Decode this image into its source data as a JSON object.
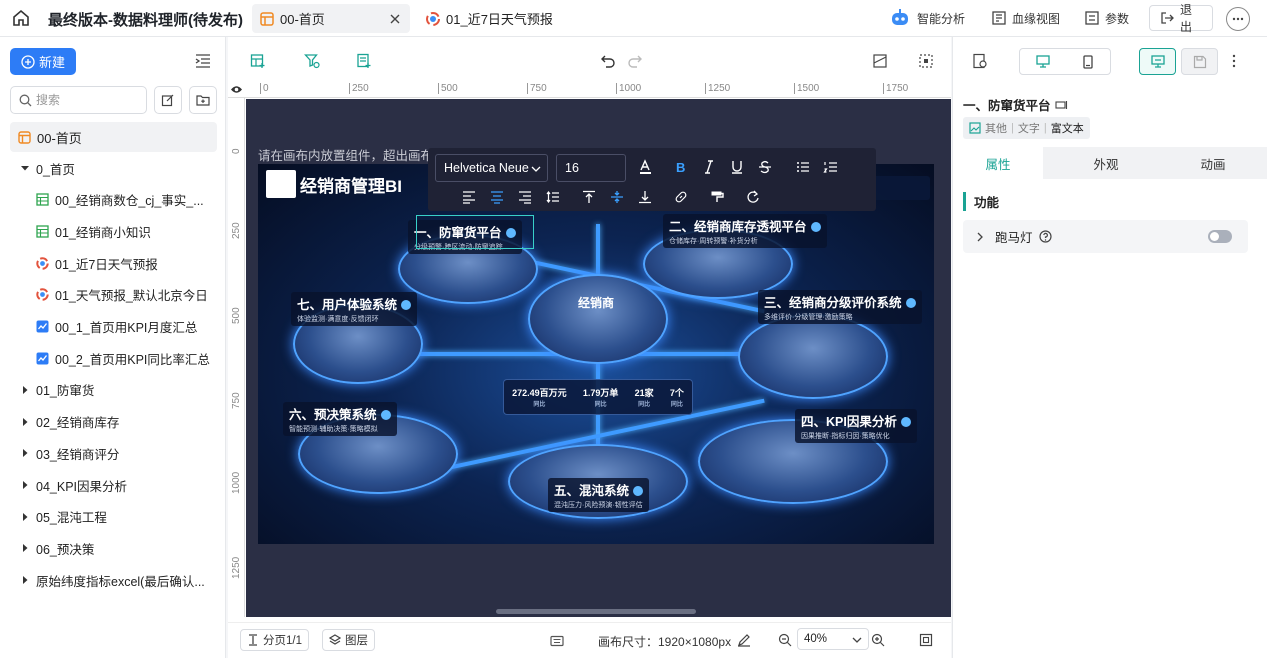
{
  "header": {
    "app_title": "最终版本-数据料理师(待发布)",
    "tabs": [
      {
        "label": "00-首页",
        "active": true
      },
      {
        "label": "01_近7日天气预报",
        "active": false
      }
    ],
    "actions": {
      "ai": "智能分析",
      "lineage": "血缘视图",
      "params": "参数",
      "exit": "退出"
    }
  },
  "sidebar": {
    "new_label": "新建",
    "search_placeholder": "搜索",
    "root": "00-首页",
    "items": [
      {
        "label": "0_首页",
        "type": "folder-open",
        "indent": 1
      },
      {
        "label": "00_经销商数仓_cj_事实_...",
        "type": "table",
        "indent": 2
      },
      {
        "label": "01_经销商小知识",
        "type": "table",
        "indent": 2
      },
      {
        "label": "01_近7日天气预报",
        "type": "chart",
        "indent": 2
      },
      {
        "label": "01_天气预报_默认北京今日",
        "type": "chart",
        "indent": 2
      },
      {
        "label": "00_1_首页用KPI月度汇总",
        "type": "line",
        "indent": 2
      },
      {
        "label": "00_2_首页用KPI同比率汇总",
        "type": "line",
        "indent": 2
      },
      {
        "label": "01_防窜货",
        "type": "folder",
        "indent": 1
      },
      {
        "label": "02_经销商库存",
        "type": "folder",
        "indent": 1
      },
      {
        "label": "03_经销商评分",
        "type": "folder",
        "indent": 1
      },
      {
        "label": "04_KPI因果分析",
        "type": "folder",
        "indent": 1
      },
      {
        "label": "05_混沌工程",
        "type": "folder",
        "indent": 1
      },
      {
        "label": "06_预决策",
        "type": "folder",
        "indent": 1
      },
      {
        "label": "原始纬度指标excel(最后确认...",
        "type": "folder",
        "indent": 1
      }
    ]
  },
  "canvas": {
    "ruler_x": [
      "0",
      "250",
      "500",
      "750",
      "1000",
      "1250",
      "1500",
      "1750"
    ],
    "ruler_y": [
      "0",
      "250",
      "500",
      "750",
      "1000",
      "1250"
    ],
    "hint": "请在画布内放置组件，超出画布外的内容无法显示",
    "picture": {
      "title": "经销商管理BI",
      "center": "经销商",
      "modules": [
        {
          "name": "一、防窜货平台",
          "sub": "分级预警·跨区流动·防窜追踪"
        },
        {
          "name": "二、经销商库存透视平台",
          "sub": "仓储库存·周转预警·补货分析"
        },
        {
          "name": "三、经销商分级评价系统",
          "sub": "多维评价·分级管理·激励策略"
        },
        {
          "name": "四、KPI因果分析",
          "sub": "因果推断·指标归因·策略优化"
        },
        {
          "name": "五、混沌系统",
          "sub": "混沌压力·风险预演·韧性评估"
        },
        {
          "name": "六、预决策系统",
          "sub": "智能预测·辅助决策·策略模拟"
        },
        {
          "name": "七、用户体验系统",
          "sub": "体验监测·满意度·反馈闭环"
        }
      ],
      "stats": [
        {
          "value": "272.49百万元",
          "note": "同比"
        },
        {
          "value": "1.79万单",
          "note": "同比"
        },
        {
          "value": "21家",
          "note": "同比"
        },
        {
          "value": "7个",
          "note": "同比"
        }
      ]
    },
    "format_bar": {
      "font": "Helvetica Neue",
      "size": "16"
    },
    "footer": {
      "pages": "分页1/1",
      "layers": "图层",
      "size_label": "画布尺寸：1920×1080px",
      "zoom": "40%"
    }
  },
  "inspector": {
    "component_name": "一、防窜货平台",
    "breadcrumb": [
      "其他",
      "文字",
      "富文本"
    ],
    "tabs": [
      "属性",
      "外观",
      "动画"
    ],
    "section": "功能",
    "marquee_label": "跑马灯",
    "marquee_on": false
  },
  "colors": {
    "accent": "#2d7cf6",
    "teal": "#1aa394",
    "stage": "#2b2f45"
  }
}
